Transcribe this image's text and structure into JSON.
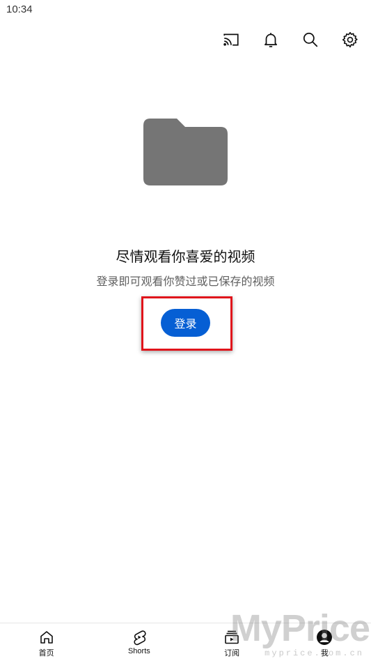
{
  "status_bar": {
    "time": "10:34"
  },
  "top_actions": [
    {
      "icon": "cast-icon"
    },
    {
      "icon": "bell-icon"
    },
    {
      "icon": "search-icon"
    },
    {
      "icon": "gear-icon"
    }
  ],
  "empty_state": {
    "icon": "folder-icon",
    "title": "尽情观看你喜爱的视频",
    "subtitle": "登录即可观看你赞过或已保存的视频",
    "signin_label": "登录"
  },
  "bottom_nav": [
    {
      "label": "首页",
      "icon": "home-icon"
    },
    {
      "label": "Shorts",
      "icon": "shorts-icon"
    },
    {
      "label": "订阅",
      "icon": "subscriptions-icon"
    },
    {
      "label": "我",
      "icon": "account-icon"
    }
  ],
  "watermark": {
    "brand": "MyPrice",
    "url": "myprice.com.cn"
  },
  "colors": {
    "accent": "#065fd4",
    "highlight": "#e0141b",
    "folder": "#757575"
  }
}
